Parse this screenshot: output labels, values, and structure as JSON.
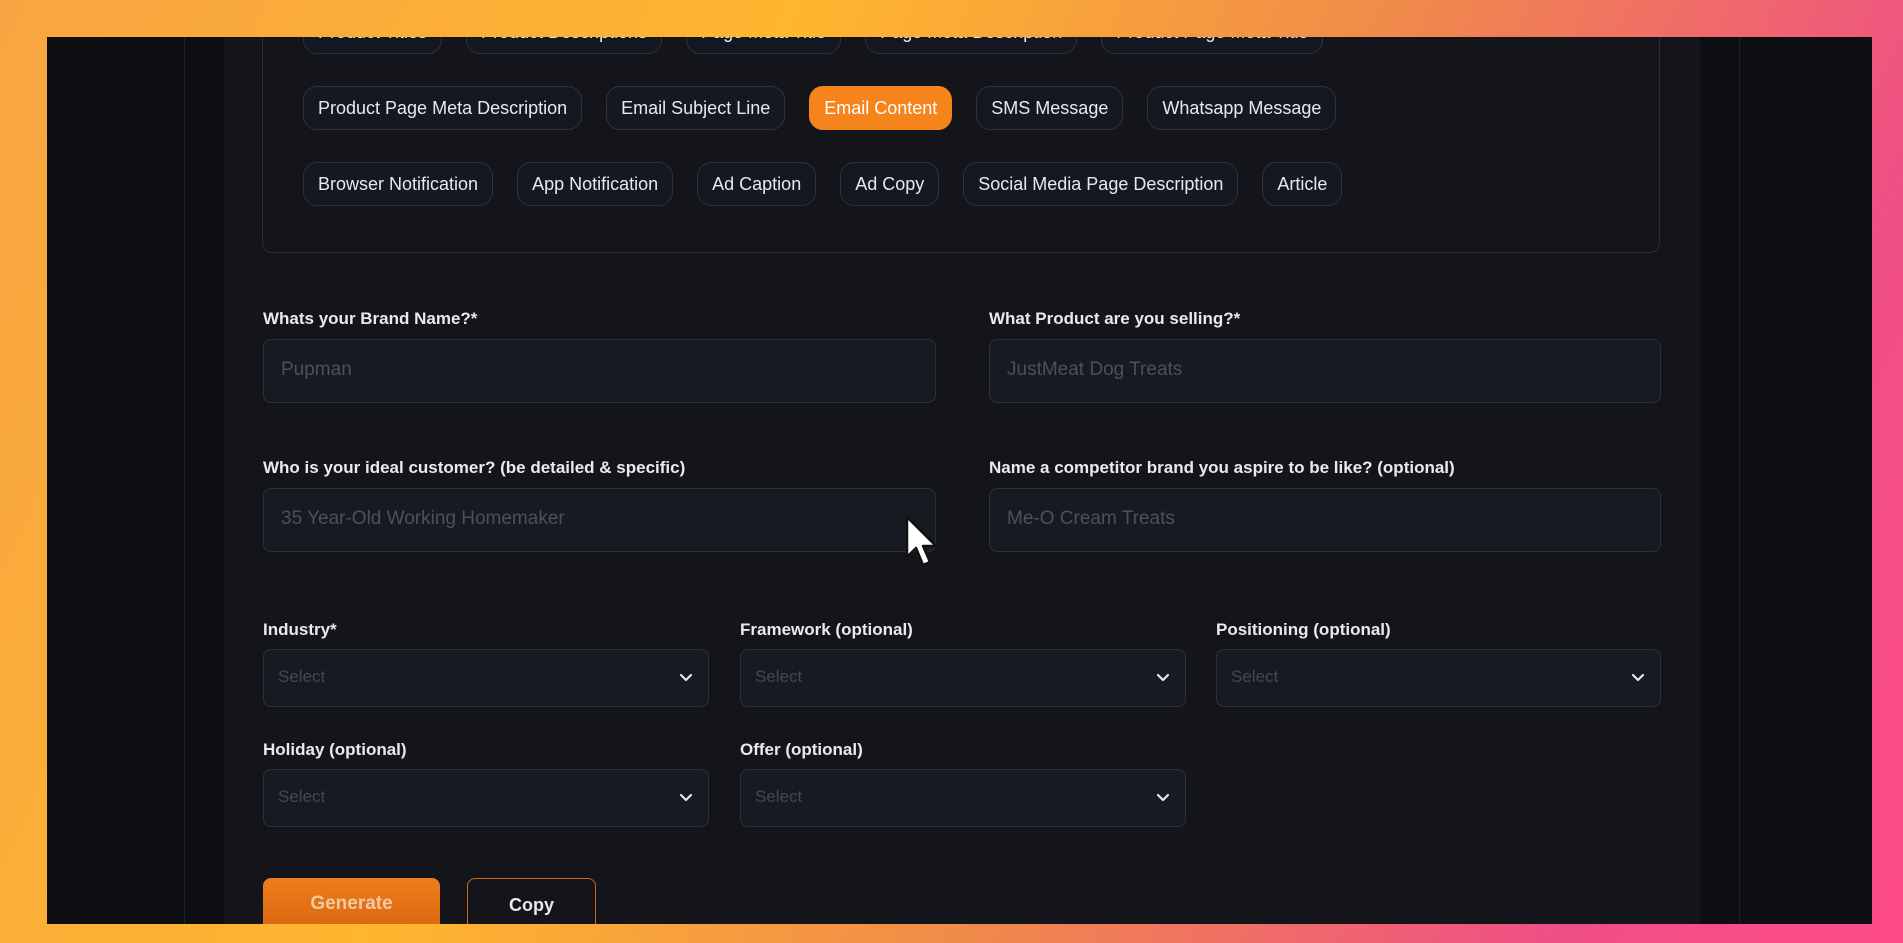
{
  "content_types": {
    "row0": [
      "Product Titles",
      "Product Descriptions",
      "Page Meta Title",
      "Page Meta Description",
      "Product Page Meta Title"
    ],
    "row1": [
      "Product Page Meta Description",
      "Email Subject Line",
      "Email Content",
      "SMS Message",
      "Whatsapp Message"
    ],
    "row2": [
      "Browser Notification",
      "App Notification",
      "Ad Caption",
      "Ad Copy",
      "Social Media Page Description",
      "Article"
    ],
    "selected": "Email Content"
  },
  "fields": {
    "brand_name": {
      "label": "Whats your Brand Name?*",
      "placeholder": "Pupman"
    },
    "product": {
      "label": "What Product are you selling?*",
      "placeholder": "JustMeat Dog Treats"
    },
    "ideal_customer": {
      "label": "Who is your ideal customer? (be detailed & specific)",
      "placeholder": "35 Year-Old Working Homemaker"
    },
    "competitor": {
      "label": "Name a competitor brand you aspire to be like? (optional)",
      "placeholder": "Me-O Cream Treats"
    }
  },
  "selects": {
    "industry": {
      "label": "Industry*",
      "value": "Select"
    },
    "framework": {
      "label": "Framework (optional)",
      "value": "Select"
    },
    "positioning": {
      "label": "Positioning (optional)",
      "value": "Select"
    },
    "holiday": {
      "label": "Holiday (optional)",
      "value": "Select"
    },
    "offer": {
      "label": "Offer (optional)",
      "value": "Select"
    }
  },
  "actions": {
    "generate": "Generate",
    "copy": "Copy"
  },
  "colors": {
    "accent": "#f6841c",
    "background": "#13151b",
    "border": "#2c303a"
  }
}
